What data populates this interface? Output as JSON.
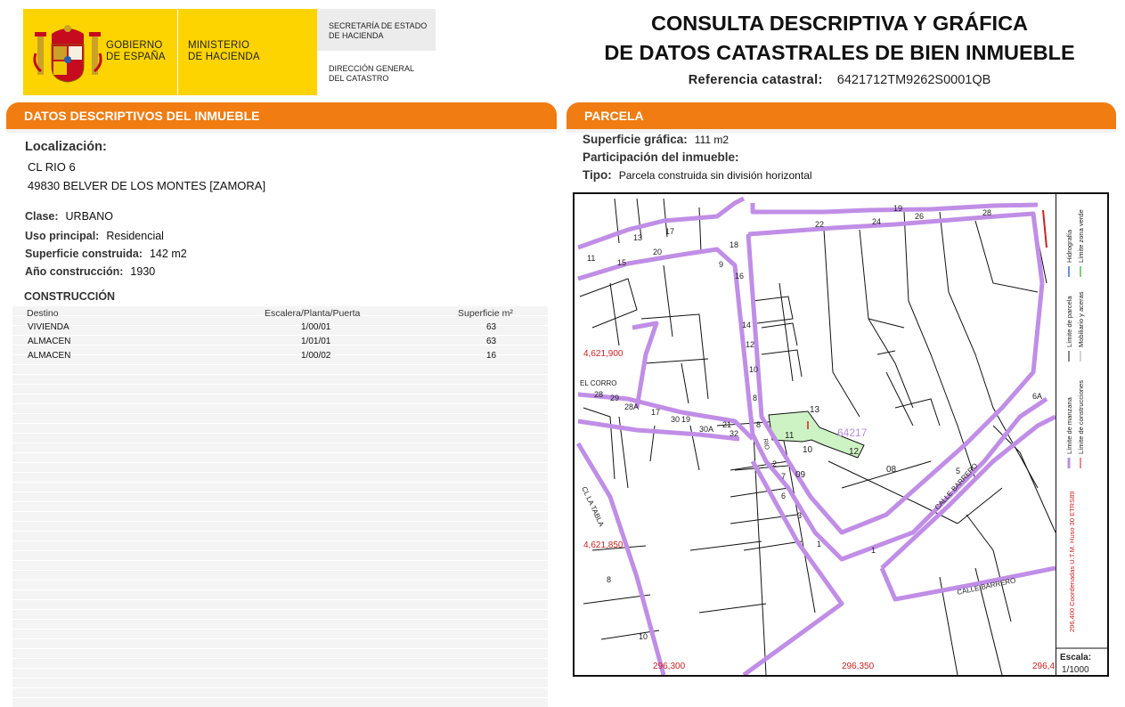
{
  "header": {
    "gobierno": [
      "GOBIERNO",
      "DE ESPAÑA"
    ],
    "ministerio": [
      "MINISTERIO",
      "DE HACIENDA"
    ],
    "secretaria": [
      "SECRETARÍA DE ESTADO",
      "DE HACIENDA"
    ],
    "direccion": [
      "DIRECCIÓN GENERAL",
      "DEL CATASTRO"
    ],
    "title_line1": "CONSULTA DESCRIPTIVA Y GRÁFICA",
    "title_line2": "DE DATOS CATASTRALES DE BIEN INMUEBLE",
    "ref_label": "Referencia catastral:",
    "ref_value": "6421712TM9262S0001QB"
  },
  "colors": {
    "accent": "#f07c12",
    "yellow": "#fdd400",
    "parcel_line": "#c08ee6",
    "highlight": "#cdf2c4",
    "coord_red": "#cc2222"
  },
  "left": {
    "section_title": "DATOS DESCRIPTIVOS DEL INMUEBLE",
    "loc_label": "Localización:",
    "addr_line1": "CL RIO 6",
    "addr_line2": "49830 BELVER DE LOS MONTES [ZAMORA]",
    "clase_label": "Clase:",
    "clase_value": "URBANO",
    "uso_label": "Uso principal:",
    "uso_value": "Residencial",
    "sup_label": "Superficie construida:",
    "sup_value": "142 m2",
    "anio_label": "Año construcción:",
    "anio_value": "1930",
    "construccion_title": "CONSTRUCCIÓN",
    "table": {
      "headers": [
        "Destino",
        "Escalera/Planta/Puerta",
        "Superficie m²"
      ],
      "rows": [
        [
          "VIVIENDA",
          "1/00/01",
          "63"
        ],
        [
          "ALMACEN",
          "1/01/01",
          "63"
        ],
        [
          "ALMACEN",
          "1/00/02",
          "16"
        ]
      ]
    }
  },
  "right": {
    "section_title": "PARCELA",
    "sup_graf_label": "Superficie gráfica:",
    "sup_graf_value": "111 m2",
    "part_label": "Participación del inmueble:",
    "part_value": "",
    "tipo_label": "Tipo:",
    "tipo_value": "Parcela construida sin división horizontal",
    "map": {
      "coords_y": [
        "4,621,900",
        "4,621,850"
      ],
      "coords_x": [
        "296,300",
        "296,350",
        "296,4"
      ],
      "street_labels": [
        "EL CORRO",
        "CL LA TABLA",
        "CALLE BARRERO",
        "CALLE BARRERO",
        "RIO"
      ],
      "parcel_label": "64217",
      "numbers": [
        "11",
        "15",
        "13",
        "17",
        "18",
        "22",
        "24",
        "19",
        "26",
        "28",
        "9",
        "16",
        "20",
        "14",
        "12",
        "10",
        "8",
        "28",
        "29",
        "28A",
        "17",
        "30",
        "19",
        "21",
        "30A",
        "32",
        "8",
        "2",
        "7",
        "6",
        "3",
        "1",
        "13",
        "11",
        "10",
        "12",
        "09",
        "08",
        "5",
        "6A",
        "1",
        "8",
        "10"
      ]
    },
    "legend": {
      "items": [
        "Límite de manzana",
        "Límite de parcela",
        "Hidrografía",
        "Límite de construcciones",
        "Mobiliario y aceras",
        "Límite zona verde"
      ],
      "coords_note": "296,400 Coordenadas U.T.M. Huso 30 ETRS89",
      "escala_label": "Escala:",
      "escala_value": "1/1000"
    }
  }
}
